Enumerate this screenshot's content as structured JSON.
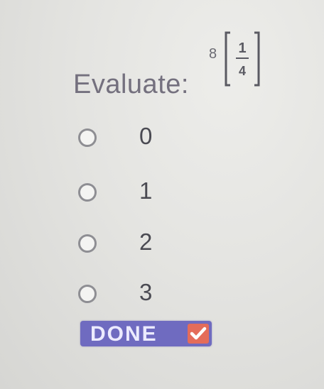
{
  "question": {
    "label": "Evaluate:",
    "expression": {
      "coefficient": "8",
      "numerator": "1",
      "denominator": "4"
    }
  },
  "options": [
    {
      "label": "0",
      "selected": false
    },
    {
      "label": "1",
      "selected": false
    },
    {
      "label": "2",
      "selected": false
    },
    {
      "label": "3",
      "selected": false
    }
  ],
  "done_button": {
    "label": "DONE",
    "icon": "checkmark-icon"
  },
  "colors": {
    "done_button": "#6f6bc0",
    "check_box": "#e46c5a",
    "text": "#74707e"
  }
}
